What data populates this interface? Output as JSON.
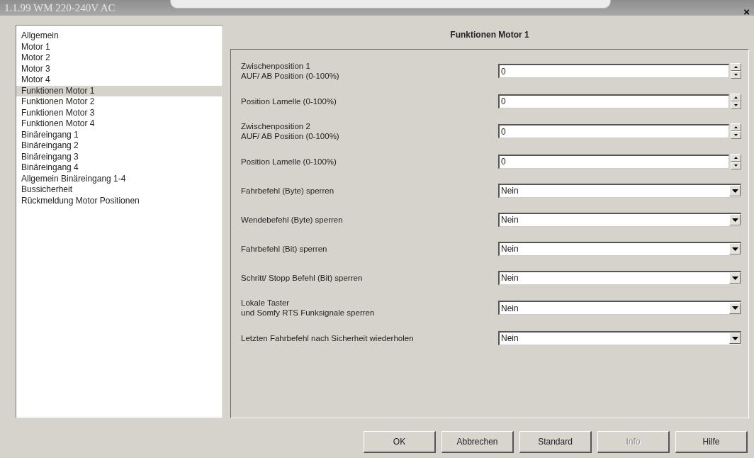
{
  "window": {
    "title": "1.1.99 WM 220-240V AC",
    "close": "×"
  },
  "sidebar": {
    "items": [
      {
        "label": "Allgemein",
        "selected": false
      },
      {
        "label": "Motor 1",
        "selected": false
      },
      {
        "label": "Motor 2",
        "selected": false
      },
      {
        "label": "Motor 3",
        "selected": false
      },
      {
        "label": "Motor 4",
        "selected": false
      },
      {
        "label": "Funktionen Motor 1",
        "selected": true
      },
      {
        "label": "Funktionen Motor 2",
        "selected": false
      },
      {
        "label": "Funktionen Motor 3",
        "selected": false
      },
      {
        "label": "Funktionen Motor 4",
        "selected": false
      },
      {
        "label": "Binäreingang 1",
        "selected": false
      },
      {
        "label": "Binäreingang 2",
        "selected": false
      },
      {
        "label": "Binäreingang 3",
        "selected": false
      },
      {
        "label": "Binäreingang 4",
        "selected": false
      },
      {
        "label": "Allgemein Binäreingang 1-4",
        "selected": false
      },
      {
        "label": "Bussicherheit",
        "selected": false
      },
      {
        "label": "Rückmeldung Motor Positionen",
        "selected": false
      }
    ]
  },
  "panel": {
    "title": "Funktionen Motor 1",
    "rows": [
      {
        "kind": "spin",
        "label": [
          "Zwischenposition 1",
          "AUF/ AB Position (0-100%)"
        ],
        "value": "0"
      },
      {
        "kind": "spin",
        "label": [
          "Position Lamelle (0-100%)"
        ],
        "value": "0"
      },
      {
        "kind": "spin",
        "label": [
          "Zwischenposition 2",
          "AUF/ AB Position (0-100%)"
        ],
        "value": "0"
      },
      {
        "kind": "spin",
        "label": [
          "Position Lamelle (0-100%)"
        ],
        "value": "0"
      },
      {
        "kind": "select",
        "label": [
          "Fahrbefehl (Byte) sperren"
        ],
        "value": "Nein"
      },
      {
        "kind": "select",
        "label": [
          "Wendebefehl (Byte) sperren"
        ],
        "value": "Nein"
      },
      {
        "kind": "select",
        "label": [
          "Fahrbefehl (Bit) sperren"
        ],
        "value": "Nein"
      },
      {
        "kind": "select",
        "label": [
          "Schritt/ Stopp Befehl (Bit) sperren"
        ],
        "value": "Nein"
      },
      {
        "kind": "select",
        "label": [
          "Lokale Taster",
          "und Somfy RTS Funksignale sperren"
        ],
        "value": "Nein"
      },
      {
        "kind": "select",
        "label": [
          "Letzten Fahrbefehl nach Sicherheit wiederholen"
        ],
        "value": "Nein"
      }
    ]
  },
  "buttons": [
    {
      "label": "OK",
      "disabled": false
    },
    {
      "label": "Abbrechen",
      "disabled": false
    },
    {
      "label": "Standard",
      "disabled": false
    },
    {
      "label": "Info",
      "disabled": true
    },
    {
      "label": "Hilfe",
      "disabled": false
    }
  ]
}
